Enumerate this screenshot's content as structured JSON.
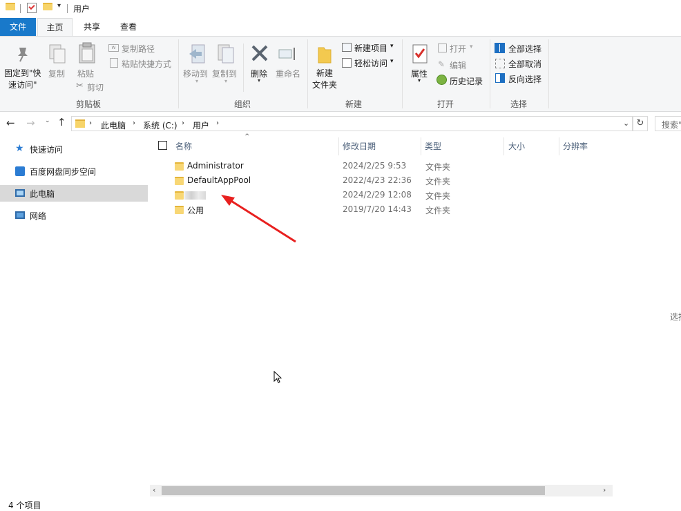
{
  "title": {
    "path_label": "用户"
  },
  "tabs": {
    "file": "文件",
    "home": "主页",
    "share": "共享",
    "view": "查看"
  },
  "ribbon": {
    "pin_line1": "固定到\"快",
    "pin_line2": "速访问\"",
    "copy": "复制",
    "paste": "粘贴",
    "copy_path": "复制路径",
    "paste_shortcut": "粘贴快捷方式",
    "cut": "剪切",
    "clipboard_group": "剪贴板",
    "move_to": "移动到",
    "copy_to": "复制到",
    "delete": "删除",
    "rename": "重命名",
    "organize_group": "组织",
    "new_folder_line1": "新建",
    "new_folder_line2": "文件夹",
    "new_item": "新建项目",
    "easy_access": "轻松访问",
    "new_group": "新建",
    "properties": "属性",
    "open": "打开",
    "edit": "编辑",
    "history": "历史记录",
    "open_group": "打开",
    "select_all": "全部选择",
    "select_none": "全部取消",
    "invert_selection": "反向选择",
    "select_group": "选择"
  },
  "address": {
    "crumbs": [
      "此电脑",
      "系统 (C:)",
      "用户"
    ],
    "search_placeholder": "搜索\""
  },
  "nav": {
    "items": [
      {
        "label": "快速访问",
        "icon": "star-icon"
      },
      {
        "label": "百度网盘同步空间",
        "icon": "cloud-drive-icon"
      },
      {
        "label": "此电脑",
        "icon": "computer-icon"
      },
      {
        "label": "网络",
        "icon": "network-icon"
      }
    ]
  },
  "columns": {
    "name": "名称",
    "modified": "修改日期",
    "type": "类型",
    "size": "大小",
    "resolution": "分辨率"
  },
  "files": [
    {
      "name": "Administrator",
      "modified": "2024/2/25 9:53",
      "type": "文件夹"
    },
    {
      "name": "DefaultAppPool",
      "modified": "2022/4/23 22:36",
      "type": "文件夹"
    },
    {
      "name": "",
      "modified": "2024/2/29 12:08",
      "type": "文件夹"
    },
    {
      "name": "公用",
      "modified": "2019/7/20 14:43",
      "type": "文件夹"
    }
  ],
  "preview_hint": "选择",
  "status": {
    "item_count": "4 个项目"
  },
  "colors": {
    "file_tab": "#1979ca",
    "arrow": "#e8201f",
    "folder": "#f8d775"
  }
}
